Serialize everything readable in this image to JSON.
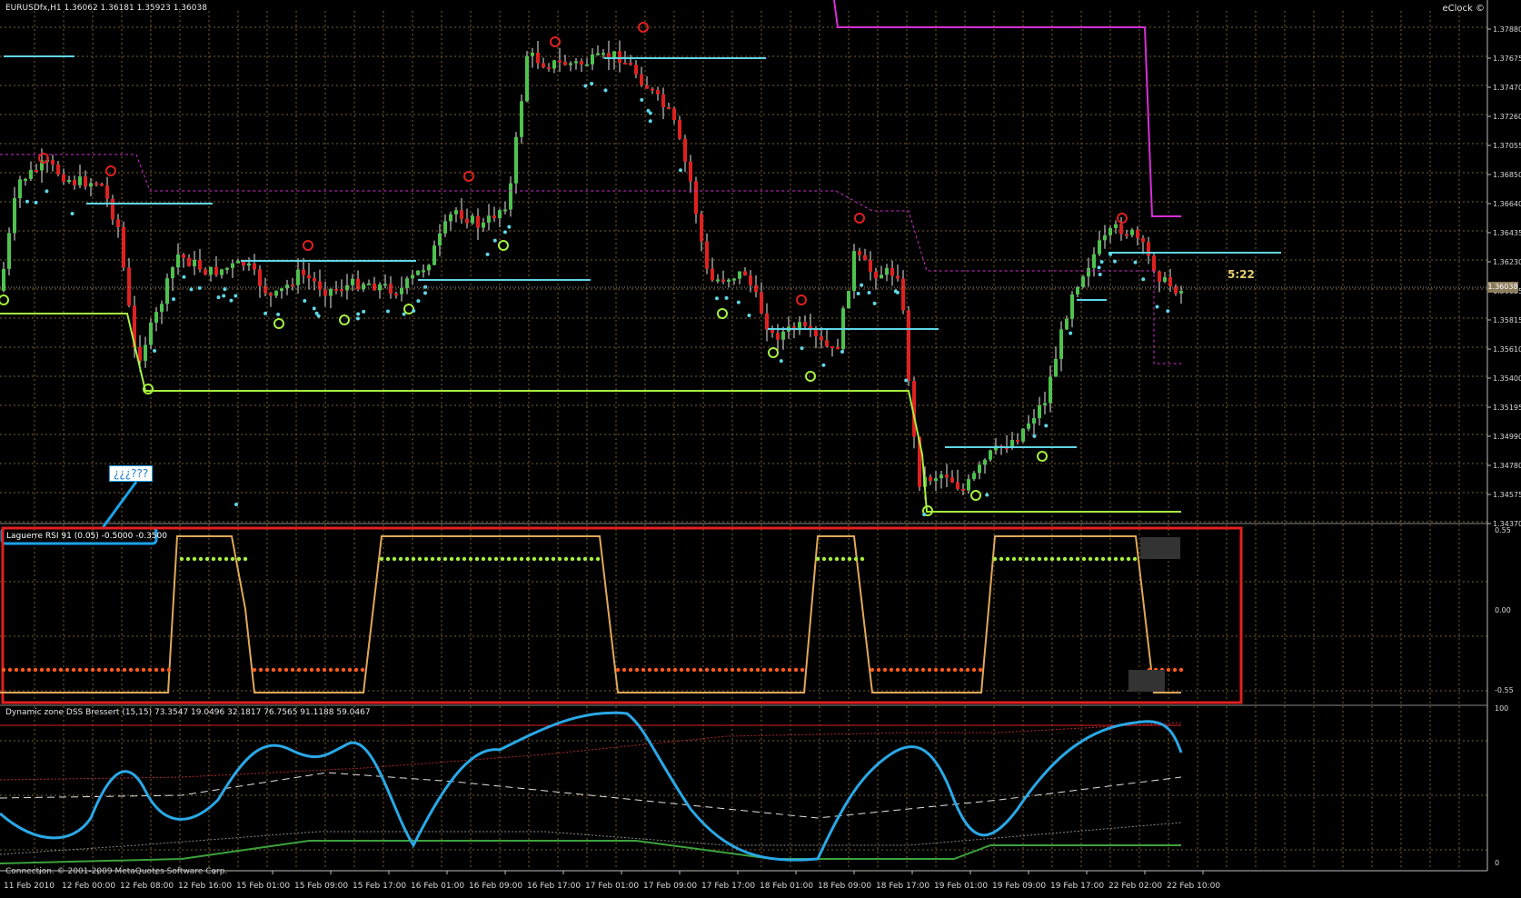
{
  "main_chart": {
    "header": "EURUSDfx,H1  1.36062 1.36181 1.35923 1.36038",
    "clock_label": "eClock ©",
    "timer": "5:22",
    "current_price": "1.36038",
    "price_ticks": [
      "1.37880",
      "1.37675",
      "1.37470",
      "1.37260",
      "1.37055",
      "1.36850",
      "1.36640",
      "1.36435",
      "1.36230",
      "1.36025",
      "1.35815",
      "1.35610",
      "1.35400",
      "1.35195",
      "1.34990",
      "1.34780",
      "1.34575",
      "1.34370"
    ]
  },
  "annotation": {
    "callout_text": "¿¿¿???"
  },
  "laguerre_panel": {
    "title": "Laguerre RSI 91 (0.05) -0.5000 -0.3500",
    "ticks": [
      "0.55",
      "0.00",
      "-0.55"
    ]
  },
  "dss_panel": {
    "title": "Dynamic zone DSS Bressert (15,15) 73.3547 19.0496 32.1817 76.7565 91.1188 59.0467",
    "ticks": [
      "100",
      "0"
    ]
  },
  "time_axis": [
    "11 Feb 2010",
    "12 Feb 00:00",
    "12 Feb 08:00",
    "12 Feb 16:00",
    "15 Feb 01:00",
    "15 Feb 09:00",
    "15 Feb 17:00",
    "16 Feb 01:00",
    "16 Feb 09:00",
    "16 Feb 17:00",
    "17 Feb 01:00",
    "17 Feb 09:00",
    "17 Feb 17:00",
    "18 Feb 01:00",
    "18 Feb 09:00",
    "18 Feb 17:00",
    "19 Feb 01:00",
    "19 Feb 09:00",
    "19 Feb 17:00",
    "22 Feb 02:00",
    "22 Feb 10:00"
  ],
  "status_bar": "Connection. © 2001-2009 MetaQuotes Software Corp.",
  "colors": {
    "grid": "#7a6030",
    "bull": "#4ec24e",
    "bear": "#e02020",
    "cyan": "#5fd6e6",
    "magenta": "#d62ed6",
    "lime": "#a6f040",
    "orange_line": "#e0a858",
    "red_box": "#e02020",
    "blue_callout": "#1aa3e8",
    "dss_blue": "#2aa8e6"
  }
}
